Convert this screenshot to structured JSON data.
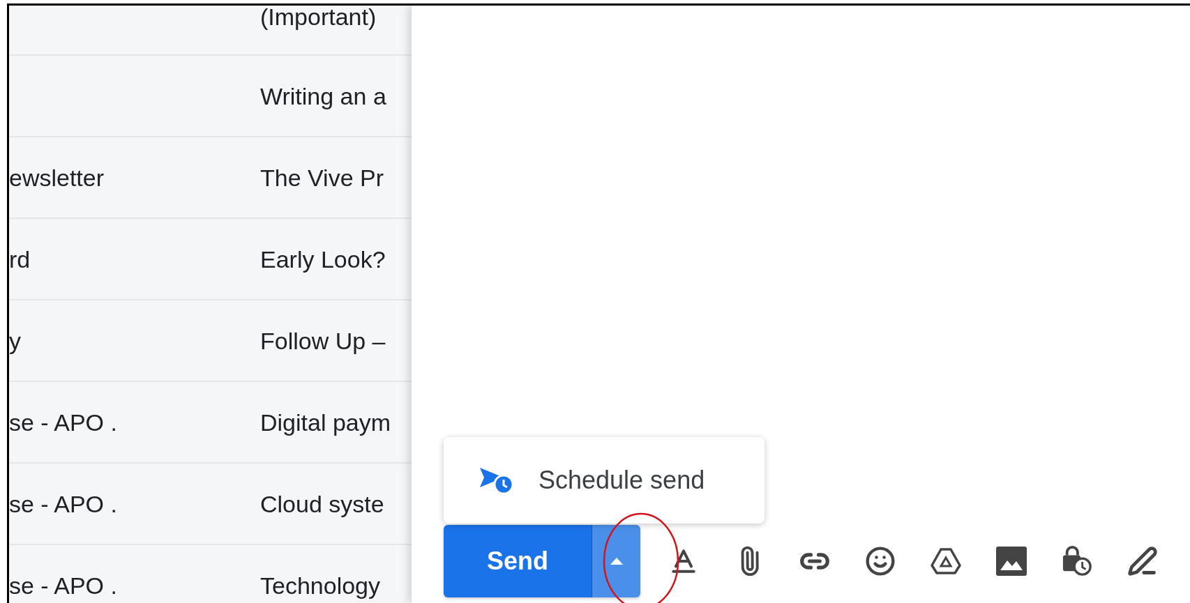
{
  "mail_list": {
    "rows": [
      {
        "subject": "(Important)"
      },
      {
        "subject": "Writing an a"
      },
      {
        "sender": "ewsletter",
        "subject": "The Vive Pr"
      },
      {
        "sender": "rd",
        "subject": "Early Look?"
      },
      {
        "sender": "y",
        "subject": "Follow Up –"
      },
      {
        "sender": "se - APO .",
        "subject": "Digital paym"
      },
      {
        "sender": "se - APO .",
        "subject": "Cloud syste"
      },
      {
        "sender": "se - APO .",
        "subject": "Technology"
      }
    ]
  },
  "compose": {
    "menu": {
      "items": [
        {
          "label": "Schedule send"
        }
      ]
    },
    "send_button": {
      "label": "Send"
    }
  }
}
